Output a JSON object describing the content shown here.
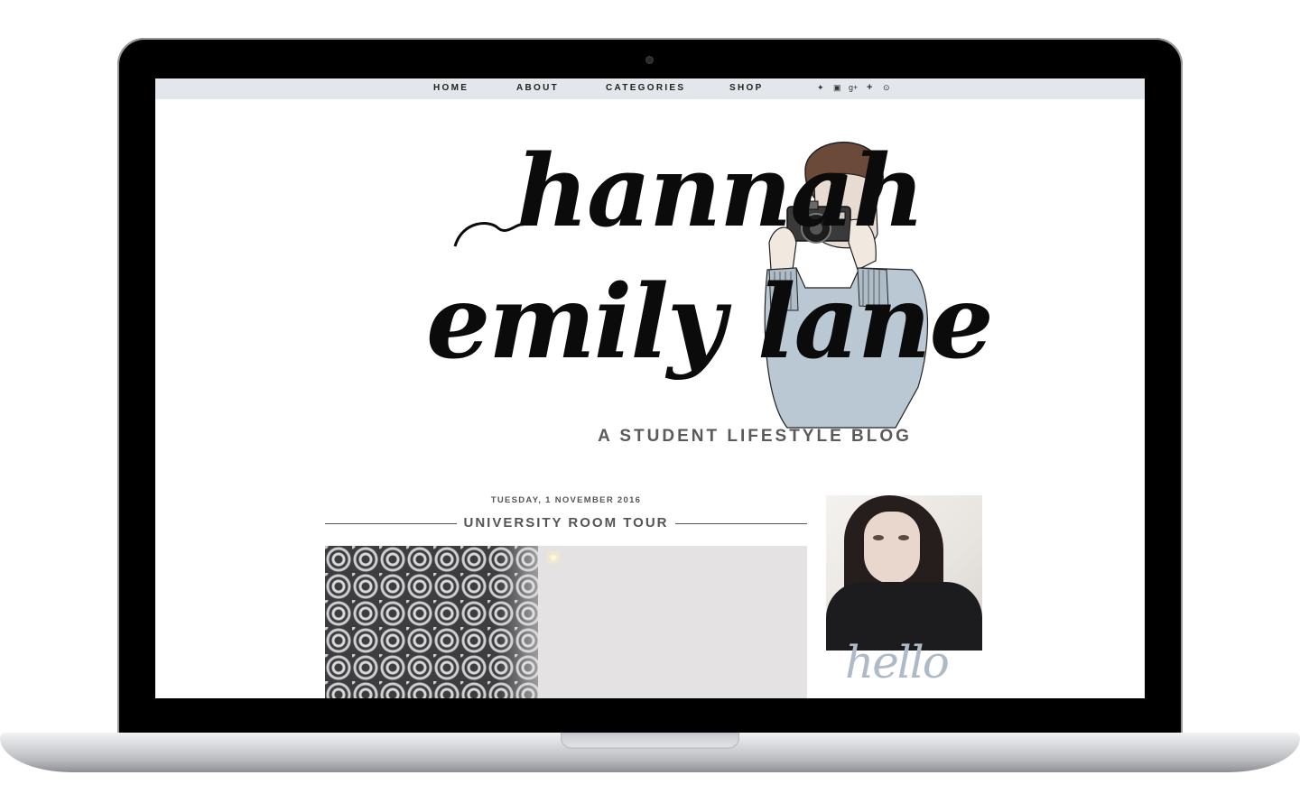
{
  "nav": {
    "items": [
      "HOME",
      "ABOUT",
      "CATEGORIES",
      "SHOP"
    ],
    "social_icons": [
      "twitter-icon",
      "instagram-icon",
      "google-plus-icon",
      "bloglovin-icon",
      "pinterest-icon"
    ],
    "social_glyphs": [
      "✦",
      "▣",
      "g+",
      "+",
      "⊙"
    ]
  },
  "header": {
    "logo_line1": "hannah",
    "logo_line2": "emily lane",
    "tagline": "A STUDENT LIFESTYLE BLOG"
  },
  "post": {
    "date": "TUESDAY, 1 NOVEMBER 2016",
    "title": "UNIVERSITY ROOM TOUR"
  },
  "sidebar": {
    "greeting": "hello"
  },
  "colors": {
    "nav_bg": "#e3e6ea",
    "sweater_blue": "#b9c8d3",
    "text_grey": "#555555",
    "hello_blue": "#aebbc7"
  }
}
